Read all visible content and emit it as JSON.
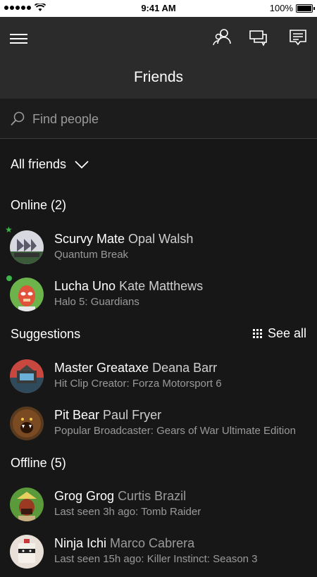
{
  "status": {
    "time": "9:41 AM",
    "battery": "100%"
  },
  "header": {
    "title": "Friends"
  },
  "search": {
    "placeholder": "Find people"
  },
  "filter": {
    "label": "All friends"
  },
  "sections": {
    "online": {
      "label": "Online",
      "count": "(2)"
    },
    "suggestions": {
      "label": "Suggestions",
      "see_all": "See all"
    },
    "offline": {
      "label": "Offline",
      "count": "(5)"
    }
  },
  "online": [
    {
      "gamertag": "Scurvy Mate",
      "real_name": "Opal Walsh",
      "activity": "Quantum Break",
      "presence": "star"
    },
    {
      "gamertag": "Lucha Uno",
      "real_name": "Kate Matthews",
      "activity": "Halo 5: Guardians",
      "presence": "dot"
    }
  ],
  "suggestions": [
    {
      "gamertag": "Master Greataxe",
      "real_name": "Deana Barr",
      "activity": "Hit Clip Creator: Forza Motorsport 6"
    },
    {
      "gamertag": "Pit Bear",
      "real_name": "Paul Fryer",
      "activity": "Popular Broadcaster: Gears of War Ultimate Edition"
    }
  ],
  "offline": [
    {
      "gamertag": "Grog Grog",
      "real_name": "Curtis Brazil",
      "activity": "Last seen 3h ago: Tomb Raider"
    },
    {
      "gamertag": "Ninja Ichi",
      "real_name": "Marco Cabrera",
      "activity": "Last seen 15h ago: Killer Instinct: Season 3"
    }
  ],
  "colors": {
    "accent_green": "#3db54a",
    "header_bg": "#2b2b2b",
    "page_bg": "#171717"
  }
}
